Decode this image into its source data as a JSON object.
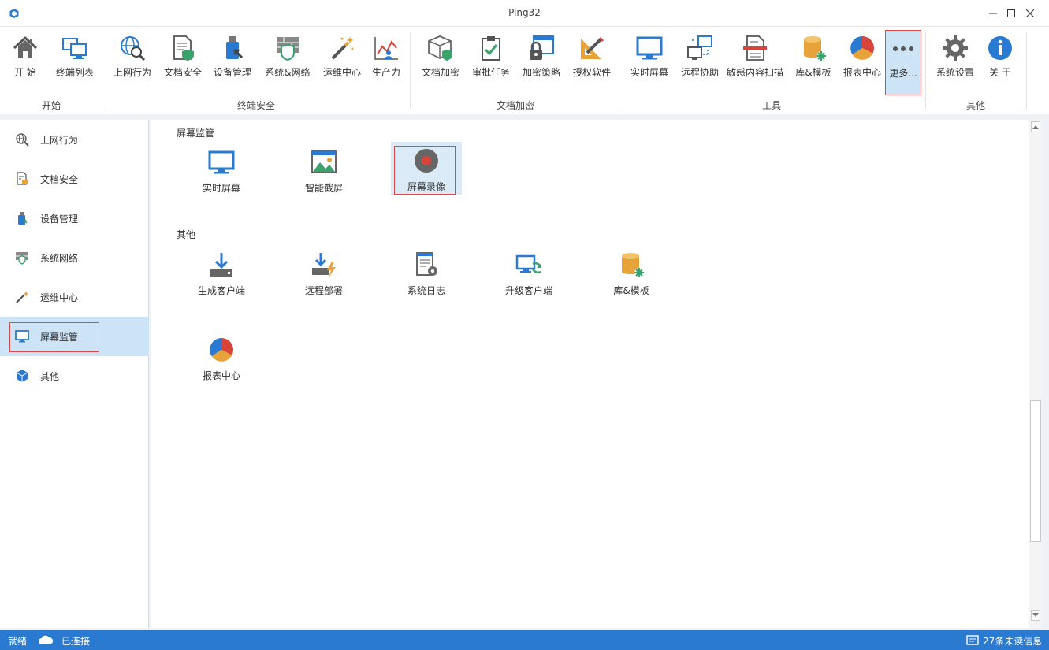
{
  "window": {
    "title": "Ping32"
  },
  "ribbon": {
    "groups": [
      {
        "label": "开始",
        "items": [
          {
            "label": "开 始",
            "icon": "home-icon"
          },
          {
            "label": "终端列表",
            "icon": "terminal-list-icon"
          }
        ]
      },
      {
        "label": "终端安全",
        "items": [
          {
            "label": "上网行为",
            "icon": "globe-search-icon"
          },
          {
            "label": "文档安全",
            "icon": "document-shield-icon"
          },
          {
            "label": "设备管理",
            "icon": "usb-device-icon"
          },
          {
            "label": "系统&网络",
            "icon": "firewall-icon"
          },
          {
            "label": "运维中心",
            "icon": "magic-wand-icon"
          },
          {
            "label": "生产力",
            "icon": "productivity-chart-icon"
          }
        ]
      },
      {
        "label": "文档加密",
        "items": [
          {
            "label": "文档加密",
            "icon": "cube-shield-icon"
          },
          {
            "label": "审批任务",
            "icon": "clipboard-check-icon"
          },
          {
            "label": "加密策略",
            "icon": "lock-window-icon"
          },
          {
            "label": "授权软件",
            "icon": "ruler-pencil-icon"
          }
        ]
      },
      {
        "label": "工具",
        "items": [
          {
            "label": "实时屏幕",
            "icon": "monitor-icon"
          },
          {
            "label": "远程协助",
            "icon": "remote-assist-icon"
          },
          {
            "label": "敏感内容扫描",
            "icon": "document-scan-icon"
          },
          {
            "label": "库&模板",
            "icon": "database-gear-icon"
          },
          {
            "label": "报表中心",
            "icon": "pie-chart-icon"
          },
          {
            "label": "更多...",
            "icon": "more-dots-icon"
          }
        ]
      },
      {
        "label": "其他",
        "items": [
          {
            "label": "系统设置",
            "icon": "gear-icon"
          },
          {
            "label": "关 于",
            "icon": "info-icon"
          }
        ]
      }
    ]
  },
  "sidebar": {
    "items": [
      {
        "label": "上网行为",
        "icon": "globe-search-icon"
      },
      {
        "label": "文档安全",
        "icon": "document-lock-icon"
      },
      {
        "label": "设备管理",
        "icon": "usb-device-icon"
      },
      {
        "label": "系统网络",
        "icon": "firewall-icon"
      },
      {
        "label": "运维中心",
        "icon": "magic-wand-icon"
      },
      {
        "label": "屏幕监管",
        "icon": "monitor-icon",
        "active": true
      },
      {
        "label": "其他",
        "icon": "cube-icon"
      }
    ]
  },
  "content": {
    "sections": [
      {
        "title": "屏幕监管",
        "tiles": [
          {
            "label": "实时屏幕",
            "icon": "monitor-icon"
          },
          {
            "label": "智能截屏",
            "icon": "landscape-image-icon"
          },
          {
            "label": "屏幕录像",
            "icon": "record-icon",
            "active": true
          }
        ]
      },
      {
        "title": "其他",
        "tiles": [
          {
            "label": "生成客户端",
            "icon": "download-tray-icon"
          },
          {
            "label": "远程部署",
            "icon": "deploy-bolt-icon"
          },
          {
            "label": "系统日志",
            "icon": "log-gear-icon"
          },
          {
            "label": "升级客户端",
            "icon": "upgrade-client-icon"
          },
          {
            "label": "库&模板",
            "icon": "database-gear-icon"
          },
          {
            "label": "报表中心",
            "icon": "pie-chart-icon"
          }
        ]
      }
    ]
  },
  "statusbar": {
    "ready": "就绪",
    "connection": "已连接",
    "messages": "27条未读信息"
  },
  "colors": {
    "accent": "#2a7ad2",
    "selected_bg": "#cde4f7",
    "highlight_border": "#e04848"
  }
}
